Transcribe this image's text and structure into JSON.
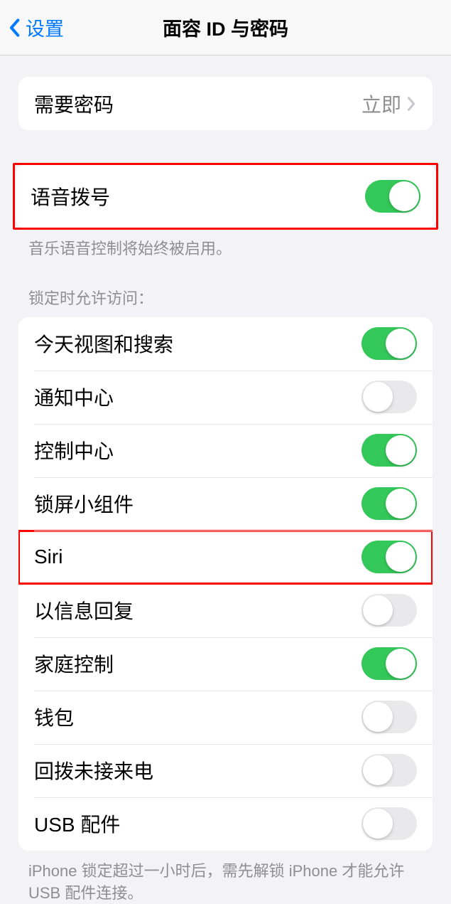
{
  "nav": {
    "back_label": "设置",
    "title": "面容 ID 与密码"
  },
  "require_passcode": {
    "label": "需要密码",
    "value": "立即"
  },
  "voice_dial": {
    "label": "语音拨号",
    "on": true,
    "footer": "音乐语音控制将始终被启用。"
  },
  "allow_access_header": "锁定时允许访问：",
  "allow_access": [
    {
      "label": "今天视图和搜索",
      "on": true,
      "highlighted": false
    },
    {
      "label": "通知中心",
      "on": false,
      "highlighted": false
    },
    {
      "label": "控制中心",
      "on": true,
      "highlighted": false
    },
    {
      "label": "锁屏小组件",
      "on": true,
      "highlighted": false
    },
    {
      "label": "Siri",
      "on": true,
      "highlighted": true
    },
    {
      "label": "以信息回复",
      "on": false,
      "highlighted": false
    },
    {
      "label": "家庭控制",
      "on": true,
      "highlighted": false
    },
    {
      "label": "钱包",
      "on": false,
      "highlighted": false
    },
    {
      "label": "回拨未接来电",
      "on": false,
      "highlighted": false
    },
    {
      "label": "USB 配件",
      "on": false,
      "highlighted": false
    }
  ],
  "allow_access_footer": "iPhone 锁定超过一小时后，需先解锁 iPhone 才能允许 USB 配件连接。"
}
